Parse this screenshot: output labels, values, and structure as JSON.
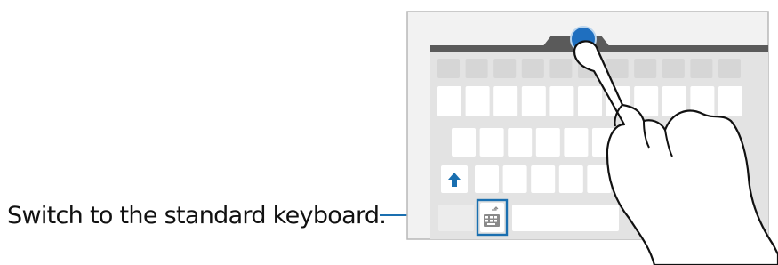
{
  "caption": {
    "text": "Switch to the standard keyboard."
  },
  "colors": {
    "panel_border": "#b8b8b8",
    "panel_bg": "#f2f2f2",
    "keyboard_bg": "#e3e3e3",
    "key_top_row": "#d6d6d6",
    "key": "#ffffff",
    "handle": "#5a5a5a",
    "accent": "#1a6fb0",
    "touch": "#1f6fbf",
    "icon_gray": "#8a8a8a"
  },
  "icons": {
    "shift": "shift-arrow-icon",
    "switch": "keyboard-switch-icon",
    "hand": "pointing-hand-icon"
  }
}
